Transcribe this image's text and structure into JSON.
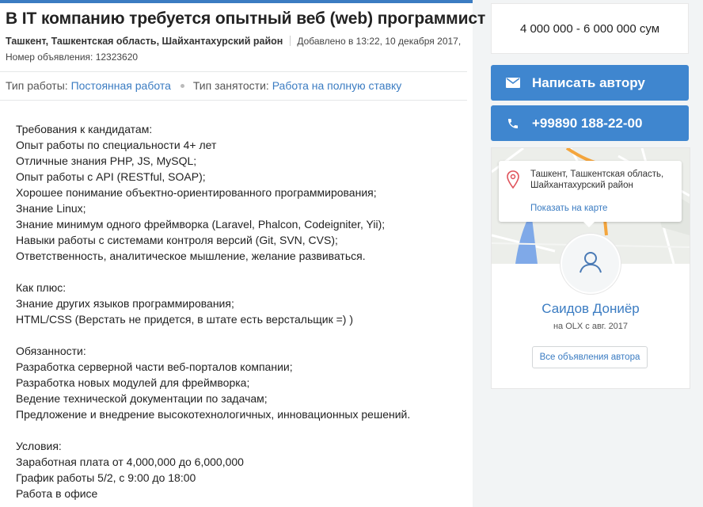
{
  "ad": {
    "title": "В IT компанию требуется опытный веб (web) программист",
    "location": "Ташкент, Ташкентская область, Шайхантахурский район",
    "added": "Добавлено в 13:22, 10 декабря 2017,",
    "ad_number": "Номер объявления: 12323620",
    "params": {
      "work_type_label": "Тип работы:",
      "work_type_value": "Постоянная работа",
      "employment_label": "Тип занятости:",
      "employment_value": "Работа на полную ставку"
    },
    "description": [
      "Требования к кандидатам:",
      "Опыт работы по специальности 4+ лет",
      "Отличные знания PHP, JS, MySQL;",
      "Опыт работы с API (RESTful, SOAP);",
      "Хорошее понимание объектно-ориентированного программирования;",
      "Знание Linux;",
      "Знание минимум одного фреймворка (Laravel, Phalcon, Codeigniter, Yii);",
      "Навыки работы с системами контроля версий (Git, SVN, CVS);",
      "Ответственность, аналитическое мышление, желание развиваться.",
      "",
      "Как плюс:",
      "Знание других языков программирования;",
      "HTML/CSS (Верстать не придется, в штате есть верстальщик =) )",
      "",
      "Обязанности:",
      "Разработка серверной части веб-порталов компании;",
      "Разработка новых модулей для фреймворка;",
      "Ведение технической документации по задачам;",
      "Предложение и внедрение высокотехнологичных, инновационных решений.",
      "",
      "Условия:",
      "Заработная плата от 4,000,000 до 6,000,000",
      "График работы 5/2, с 9:00 до 18:00",
      "Работа в офисе"
    ]
  },
  "sidebar": {
    "price": "4 000 000 - 6 000 000 сум",
    "write_button": "Написать автору",
    "phone_button": "+99890 188-22-00",
    "map_address": "Ташкент, Ташкентская область, Шайхантахурский район",
    "map_link": "Показать на карте",
    "user_name": "Саидов Дониёр",
    "user_since": "на OLX с авг. 2017",
    "all_ads_button": "Все объявления автора"
  },
  "colors": {
    "accent": "#3b7cc2",
    "button": "#3f86cf",
    "map_road": "#f4a53c",
    "map_water": "#7fa9e8"
  },
  "icons": {
    "mail": "mail-icon",
    "phone": "phone-icon",
    "pin": "map-pin-icon",
    "user": "user-icon"
  }
}
